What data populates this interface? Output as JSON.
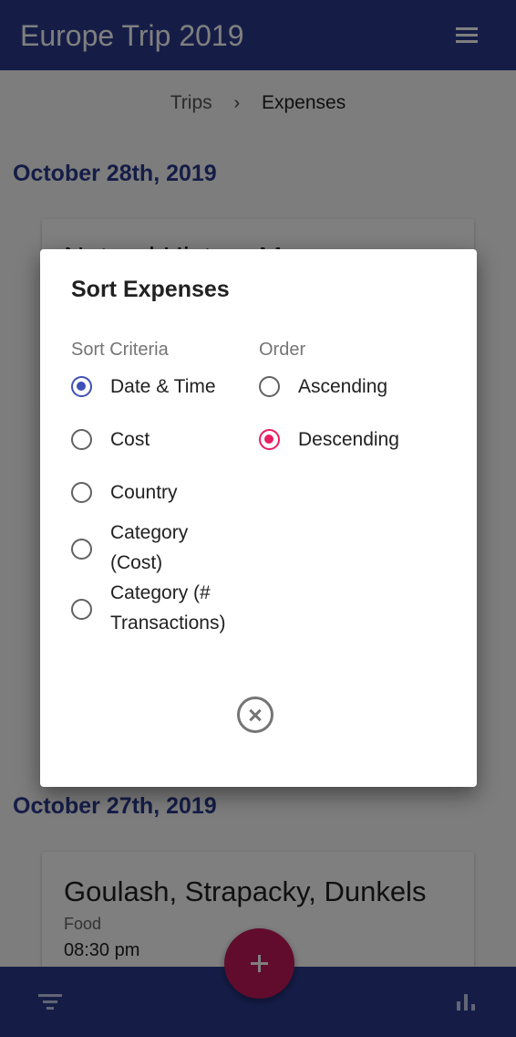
{
  "app": {
    "title": "Europe Trip 2019"
  },
  "breadcrumb": {
    "parent": "Trips",
    "separator": "›",
    "current": "Expenses"
  },
  "groups": [
    {
      "date": "October 28th, 2019",
      "cards": [
        {
          "title": "Natural History M...",
          "category": "",
          "time": ""
        }
      ]
    },
    {
      "date": "October 27th, 2019",
      "cards": [
        {
          "title": "Goulash, Strapacky, Dunkels",
          "category": "Food",
          "time": "08:30 pm"
        }
      ]
    }
  ],
  "dialog": {
    "title": "Sort Expenses",
    "criteria_label": "Sort Criteria",
    "order_label": "Order",
    "criteria": [
      {
        "line1": "Date & Time",
        "line2": "",
        "selected": true
      },
      {
        "line1": "Cost",
        "line2": "",
        "selected": false
      },
      {
        "line1": "Country",
        "line2": "",
        "selected": false
      },
      {
        "line1": "Category",
        "line2": "(Cost)",
        "selected": false
      },
      {
        "line1": "Category (#",
        "line2": "Transactions)",
        "selected": false
      }
    ],
    "order": [
      {
        "label": "Ascending",
        "selected": false
      },
      {
        "label": "Descending",
        "selected": true
      }
    ]
  },
  "icons": {
    "menu": "menu-icon",
    "filter": "filter-icon",
    "stats": "bar-chart-icon",
    "add": "plus-icon",
    "close": "close-circle-icon"
  },
  "colors": {
    "primary": "#2b3a8f",
    "accent": "#c2185b",
    "radio_criteria": "#3f51b5",
    "radio_order": "#e91e63"
  }
}
